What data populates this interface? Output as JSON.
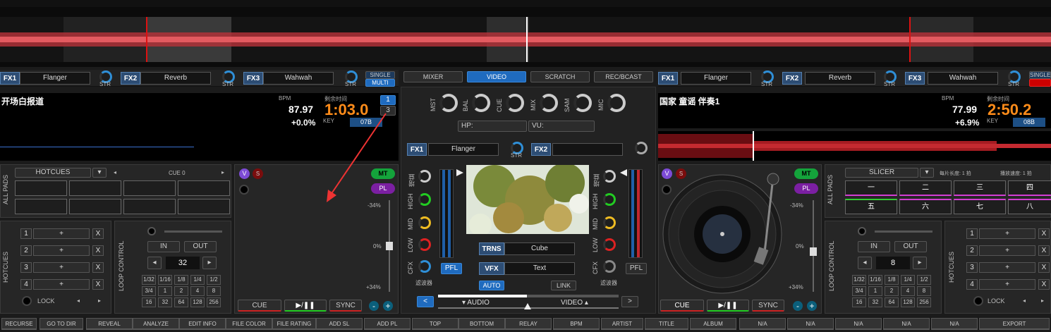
{
  "tabs": [
    "MIXER",
    "VIDEO",
    "SCRATCH",
    "REC/BCAST"
  ],
  "fx_left": [
    {
      "label": "FX1",
      "name": "Flanger"
    },
    {
      "label": "FX2",
      "name": "Reverb"
    },
    {
      "label": "FX3",
      "name": "Wahwah"
    }
  ],
  "fx_right": [
    {
      "label": "FX1",
      "name": "Flanger"
    },
    {
      "label": "FX2",
      "name": "Reverb"
    },
    {
      "label": "FX3",
      "name": "Wahwah"
    }
  ],
  "str": "STR",
  "single": "SINGLE",
  "multi": "MULTI",
  "left": {
    "title": "开场白报道",
    "bpm_label": "BPM",
    "remain_label": "剩余时间",
    "bpm": "87.97",
    "time": "1:03.0",
    "pitch": "+0.0%",
    "key_label": "KEY",
    "key": "07B",
    "deck_num1": "1",
    "deck_num2": "3",
    "pads_title": "HOTCUES",
    "cue_label": "CUE 0",
    "all_pads": "ALL PADS",
    "hotcues": "HOTCUES",
    "loop_control": "LOOP CONTROL",
    "lock": "LOCK",
    "in": "IN",
    "out": "OUT",
    "loop_len": "32",
    "rows": [
      "1",
      "2",
      "3",
      "4"
    ],
    "plus": "+",
    "x": "X",
    "sizes": [
      "1/32",
      "1/16",
      "1/8",
      "1/4",
      "1/2",
      "3/4",
      "1",
      "2",
      "4",
      "8",
      "16",
      "32",
      "64",
      "128",
      "256"
    ],
    "v": "V",
    "s": "S",
    "mt": "MT",
    "pl": "PL",
    "p1": "-34%",
    "p2": "0%",
    "p3": "+34%",
    "cue": "CUE",
    "play": "▶/❚❚",
    "sync": "SYNC"
  },
  "right": {
    "title": "国家 童谣 伴奏1",
    "bpm_label": "BPM",
    "remain_label": "剩余时间",
    "bpm": "77.99",
    "time": "2:50.2",
    "pitch": "+6.9%",
    "key_label": "KEY",
    "key": "08B",
    "pads_title": "SLICER",
    "slice_len": "每片长度: 1 拍",
    "slice_speed": "播放速度: 1 拍",
    "all_pads": "ALL PADS",
    "slices": [
      "一",
      "二",
      "三",
      "四",
      "五",
      "六",
      "七",
      "八"
    ],
    "hotcues": "HOTCUES",
    "loop_control": "LOOP CONTROL",
    "lock": "LOCK",
    "in": "IN",
    "out": "OUT",
    "loop_len": "8",
    "rows": [
      "1",
      "2",
      "3",
      "4"
    ],
    "plus": "+",
    "x": "X",
    "sizes": [
      "1/32",
      "1/16",
      "1/8",
      "1/4",
      "1/2",
      "3/4",
      "1",
      "2",
      "4",
      "8",
      "16",
      "32",
      "64",
      "128",
      "256"
    ],
    "v": "V",
    "s": "S",
    "mt": "MT",
    "pl": "PL",
    "p1": "-34%",
    "p2": "0%",
    "p3": "+34%",
    "cue": "CUE",
    "play": "▶/❚❚",
    "sync": "SYNC"
  },
  "mixer": {
    "knobs": [
      "MST",
      "BAL",
      "CUE",
      "MIX",
      "SAM",
      "MIC"
    ],
    "hp": "HP:",
    "vu": "VU:",
    "fx1": "FX1",
    "fx1_name": "Flanger",
    "fx2": "FX2",
    "str": "STR",
    "eq": [
      "增益",
      "HIGH",
      "MID",
      "LOW",
      "CFX",
      "滤波器"
    ],
    "pfl": "PFL",
    "trns": "TRNS",
    "trns_val": "Cube",
    "vfx": "VFX",
    "vfx_val": "Text",
    "auto": "AUTO",
    "link": "LINK",
    "audio": "AUDIO",
    "video": "VIDEO",
    "prev": "<",
    "next": ">"
  },
  "bottom": [
    "RECURSE",
    "GO TO DIR",
    "REVEAL",
    "ANALYZE",
    "EDIT INFO",
    "FILE COLOR",
    "FILE RATING",
    "ADD SL",
    "ADD PL",
    "TOP",
    "BOTTOM",
    "RELAY",
    "BPM",
    "ARTIST",
    "TITLE",
    "ALBUM",
    "N/A",
    "N/A",
    "N/A",
    "N/A",
    "N/A",
    "EXPORT"
  ]
}
